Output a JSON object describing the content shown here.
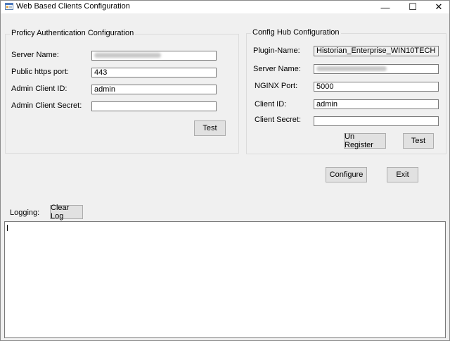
{
  "window": {
    "title": "Web Based Clients Configuration",
    "controls": {
      "minimize": "—",
      "maximize": "☐",
      "close": "✕"
    }
  },
  "proficy_auth": {
    "title": "Proficy Authentication Configuration",
    "server_name_label": "Server Name:",
    "server_name_value": "",
    "https_port_label": "Public https port:",
    "https_port_value": "443",
    "client_id_label": "Admin Client ID:",
    "client_id_value": "admin",
    "client_secret_label": "Admin Client Secret:",
    "client_secret_value": "",
    "test_label": "Test"
  },
  "config_hub": {
    "title": "Config Hub Configuration",
    "plugin_name_label": "Plugin-Name:",
    "plugin_name_value": "Historian_Enterprise_WIN10TECH",
    "server_name_label": "Server Name:",
    "server_name_value": "",
    "nginx_port_label": "NGINX Port:",
    "nginx_port_value": "5000",
    "client_id_label": "Client ID:",
    "client_id_value": "admin",
    "client_secret_label": "Client Secret:",
    "client_secret_value": "",
    "unregister_label": "Un Register",
    "test_label": "Test"
  },
  "actions": {
    "configure_label": "Configure",
    "exit_label": "Exit"
  },
  "logging": {
    "label": "Logging:",
    "clear_label": "Clear Log",
    "content": ""
  }
}
